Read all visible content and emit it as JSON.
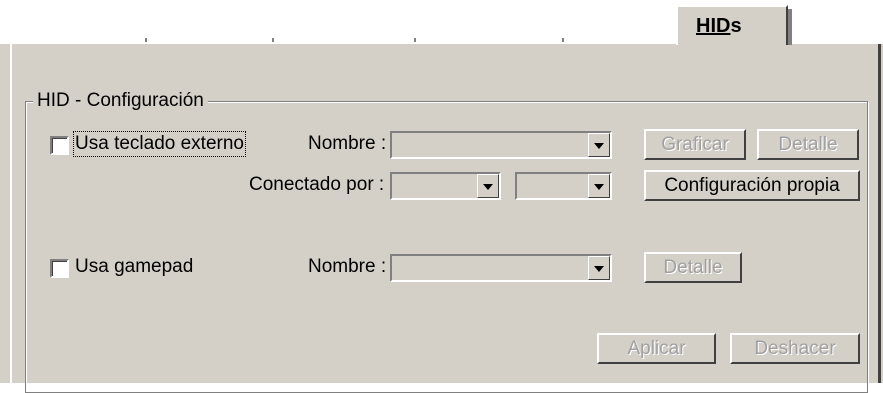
{
  "tab": {
    "label_prefix": "HID",
    "label_suffix": "s"
  },
  "group": {
    "title": "HID - Configuración"
  },
  "keyboard": {
    "checkbox_label": "Usa teclado externo",
    "checked": false,
    "name_label": "Nombre :",
    "name_value": "",
    "connected_label": "Conectado por :",
    "connected_value_1": "",
    "connected_value_2": "",
    "graph_button": "Graficar",
    "detail_button": "Detalle",
    "config_button": "Configuración propia"
  },
  "gamepad": {
    "checkbox_label": "Usa gamepad",
    "checked": false,
    "name_label": "Nombre :",
    "name_value": "",
    "detail_button": "Detalle"
  },
  "footer": {
    "apply_button": "Aplicar",
    "undo_button": "Deshacer"
  }
}
